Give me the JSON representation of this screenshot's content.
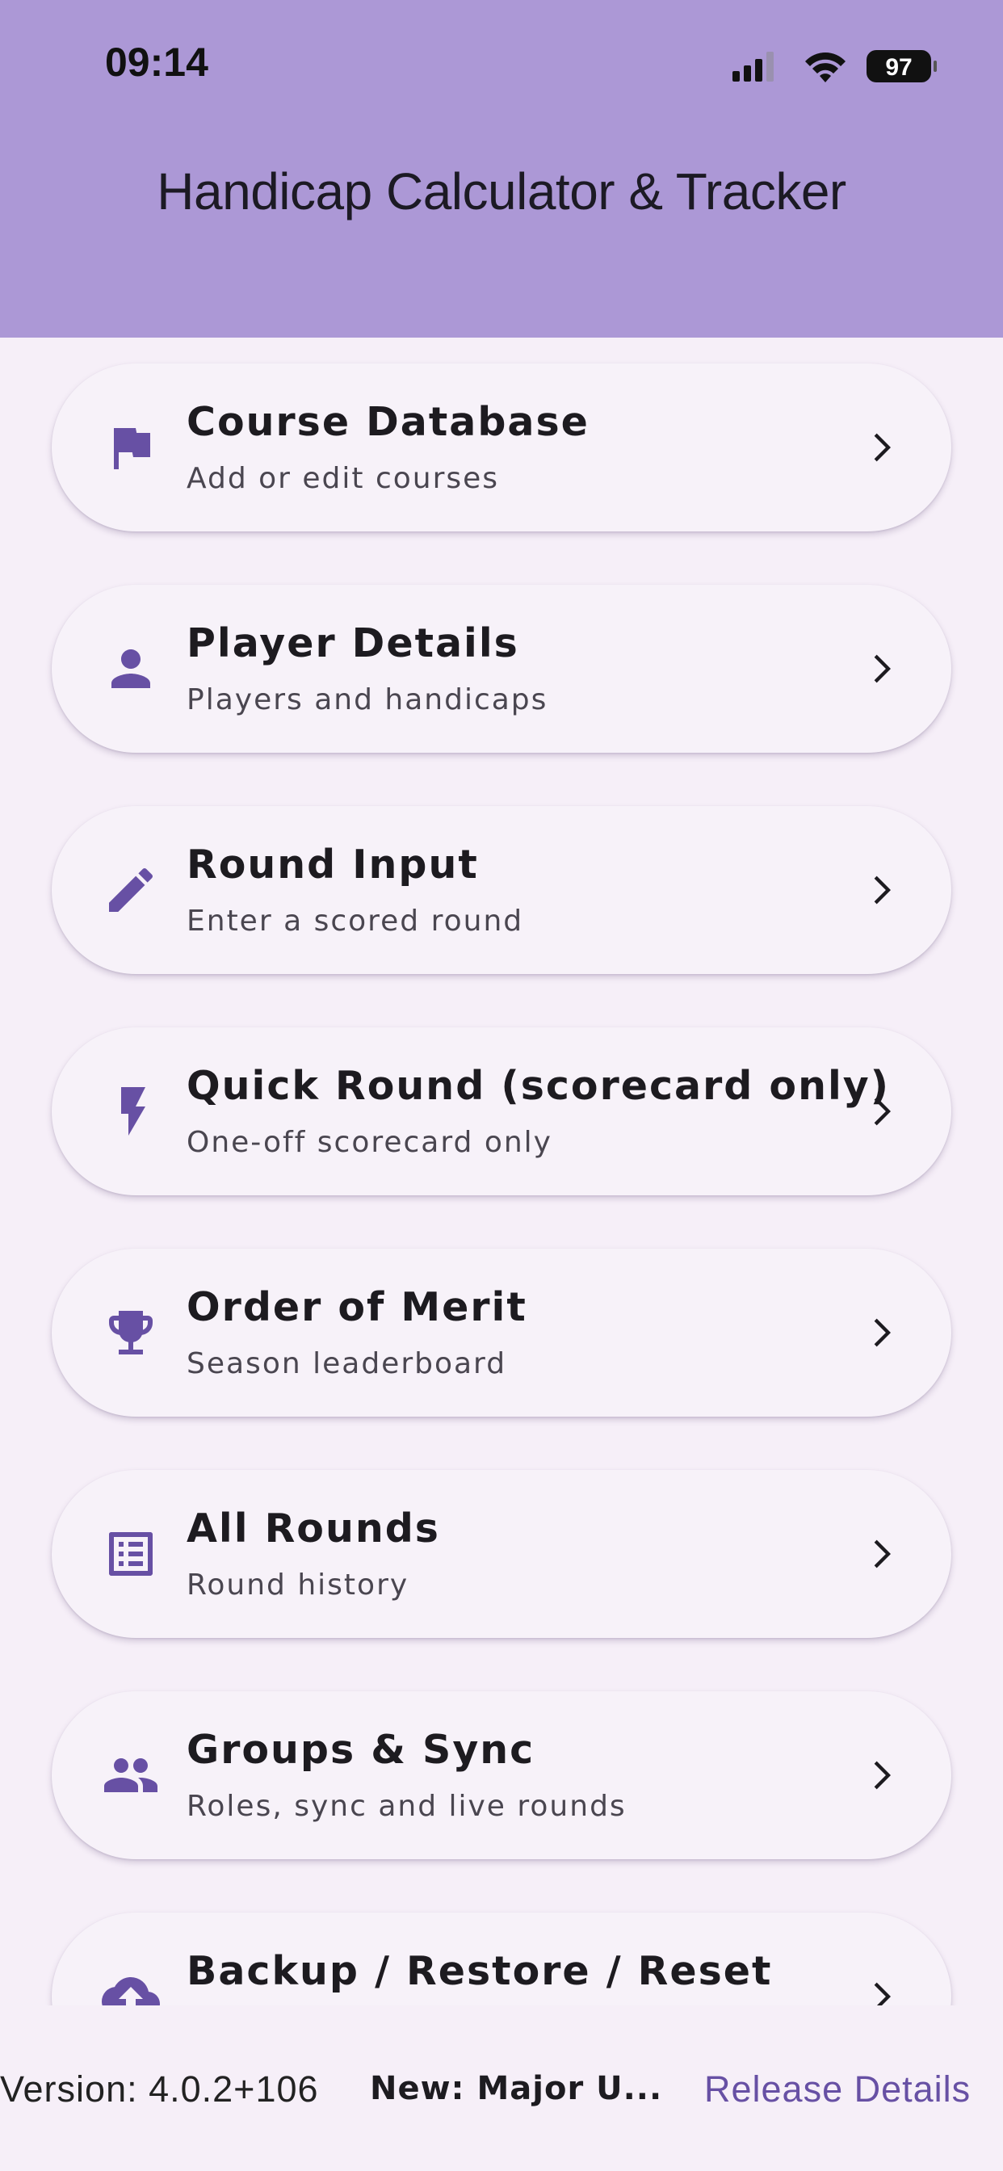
{
  "status_bar": {
    "time": "09:14",
    "battery": "97",
    "signal_icon": "cellular-signal-icon",
    "wifi_icon": "wifi-icon",
    "battery_icon": "battery-icon"
  },
  "app_bar": {
    "title": "Handicap Calculator & Tracker"
  },
  "colors": {
    "app_bar_bg": "#ac98d6",
    "page_bg": "#f6eff8",
    "card_bg": "#f7f2f9",
    "icon_color": "#6750a4",
    "link_color": "#6750a4"
  },
  "menu": {
    "items": [
      {
        "title": "Course Database",
        "subtitle": "Add or edit courses",
        "icon": "flag-icon"
      },
      {
        "title": "Player Details",
        "subtitle": "Players and handicaps",
        "icon": "person-icon"
      },
      {
        "title": "Round Input",
        "subtitle": "Enter a scored round",
        "icon": "pencil-icon"
      },
      {
        "title": "Quick Round (scorecard only)",
        "subtitle": "One-off scorecard only",
        "icon": "lightning-icon"
      },
      {
        "title": "Order of Merit",
        "subtitle": "Season leaderboard",
        "icon": "trophy-icon"
      },
      {
        "title": "All Rounds",
        "subtitle": "Round history",
        "icon": "list-icon"
      },
      {
        "title": "Groups & Sync",
        "subtitle": "Roles, sync and live rounds",
        "icon": "group-icon"
      },
      {
        "title": "Backup / Restore / Reset",
        "subtitle": "",
        "icon": "cloud-upload-icon"
      }
    ]
  },
  "footer": {
    "version": "Version: 4.0.2+106",
    "new_label": "New: Major U...",
    "release_link": "Release Details"
  }
}
